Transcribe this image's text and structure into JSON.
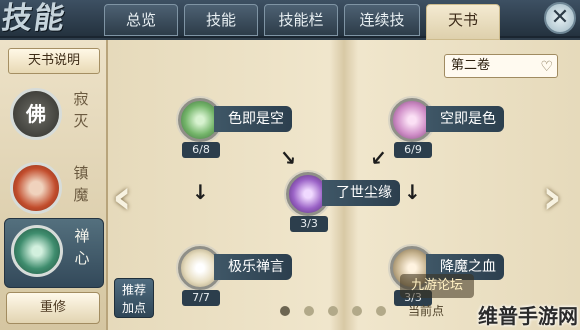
{
  "header": {
    "title": "技能",
    "tabs": [
      {
        "label": "总览",
        "active": false
      },
      {
        "label": "技能",
        "active": false
      },
      {
        "label": "技能栏",
        "active": false
      },
      {
        "label": "连续技",
        "active": false
      },
      {
        "label": "天书",
        "active": true
      }
    ],
    "close_icon": "close-icon"
  },
  "sidebar": {
    "header": "天书说明",
    "branches": [
      {
        "orb_label": "佛",
        "name": "寂灭",
        "selected": false,
        "orb_color": "#4b4b45"
      },
      {
        "orb_label": "",
        "name": "镇魔",
        "selected": false,
        "orb_color": "#b44a2c"
      },
      {
        "orb_label": "",
        "name": "禅心",
        "selected": true,
        "orb_color": "#3f8d6e"
      }
    ],
    "reset_button": "重修"
  },
  "book": {
    "volume": "第二卷",
    "skills": [
      {
        "name": "色即是空",
        "level": "6/8",
        "color": "#74b56a"
      },
      {
        "name": "空即是色",
        "level": "6/9",
        "color": "#d08fc8"
      },
      {
        "name": "了世尘缘",
        "level": "3/3",
        "color": "#9a62c6"
      },
      {
        "name": "极乐禅言",
        "level": "7/7",
        "color": "#e7ddc0"
      },
      {
        "name": "降魔之血",
        "level": "3/3",
        "color": "#c7b490"
      }
    ],
    "recommend_button": "推荐加点",
    "pager_active": 0,
    "points_label": "当前点"
  },
  "watermarks": {
    "a": "九游论坛",
    "b": "维普手游网"
  },
  "colors": {
    "accent_dark": "#2c3f4e",
    "parchment": "#efe5cb"
  }
}
